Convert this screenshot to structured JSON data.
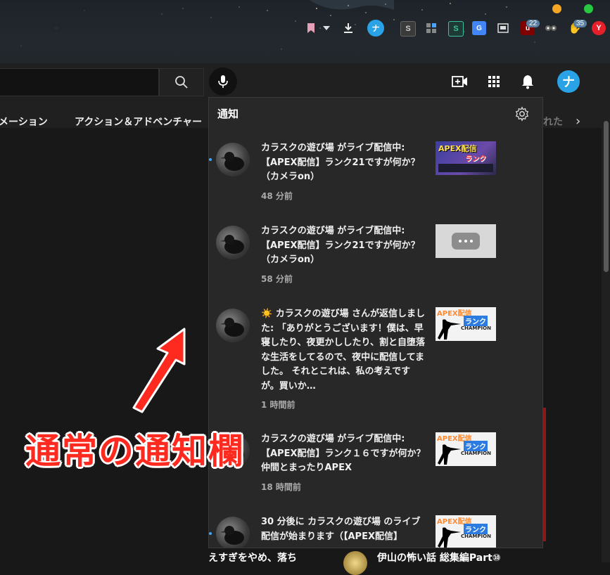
{
  "browser": {
    "traffic_colors": [
      "#f5a623",
      "#28c840"
    ],
    "extension_badges": {
      "first": "22",
      "second": "35"
    }
  },
  "header": {
    "avatar_letter": "ナ",
    "toolbar_avatar_letter": "ナ"
  },
  "chips": [
    "メーション",
    "アクション＆アドベンチャー",
    "れた"
  ],
  "panel": {
    "title": "通知",
    "notifications": [
      {
        "text": "カラスクの遊び場 がライブ配信中: 【APEX配信】ランク21ですが何か？（カメラon）",
        "time": "48 分前",
        "thumb": "apex-live-thumbnail"
      },
      {
        "text": "カラスクの遊び場 がライブ配信中: 【APEX配信】ランク21ですが何か？（カメラon）",
        "time": "58 分前",
        "thumb": "placeholder-thumbnail"
      },
      {
        "text": "☀️ カラスクの遊び場 さんが返信しました: 「ありがとうございます！僕は、早寝したり、夜更かししたり、割と自堕落な生活をしてるので、夜中に配信してました。 それとこれは、私の考えですが。買いか…",
        "time": "1 時間前",
        "thumb": "apex-rank-thumbnail"
      },
      {
        "text": "カラスクの遊び場 がライブ配信中: 【APEX配信】ランク１６ですが何か？仲間とまったりAPEX",
        "time": "18 時間前",
        "thumb": "apex-rank-thumbnail"
      },
      {
        "text": "30 分後に カラスクの遊び場 のライブ配信が始まります（【APEX配信】",
        "time": "",
        "thumb": "apex-rank-thumbnail"
      }
    ]
  },
  "bottom": {
    "left_title": "えすぎをやめ、落ち",
    "right_title": "伊山の怖い話 総集編Part⑩"
  },
  "annotation": {
    "label": "通常の通知欄",
    "color": "#ff2a1f"
  },
  "thumb_texts": {
    "apex_live": "APEX配信",
    "apex_rank": "APEX配信",
    "rank_suffix": "ランク",
    "champion": "CHAMPION"
  }
}
